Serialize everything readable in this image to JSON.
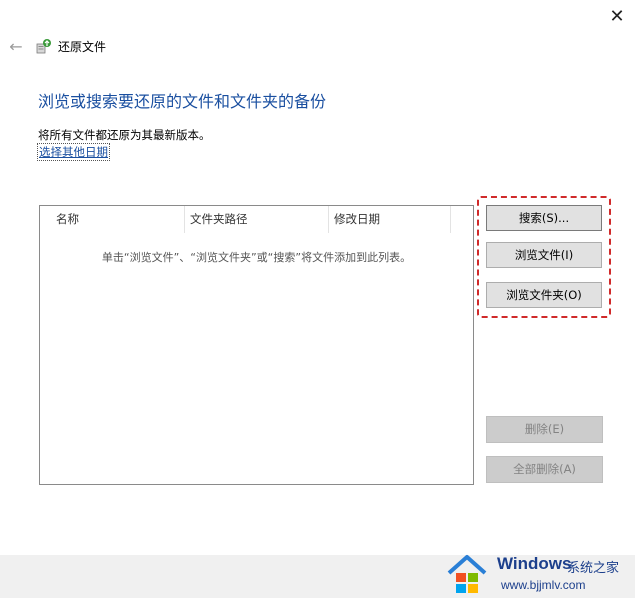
{
  "window": {
    "close_glyph": "✕",
    "back_glyph": "←",
    "title": "还原文件"
  },
  "main": {
    "heading": "浏览或搜索要还原的文件和文件夹的备份",
    "description": "将所有文件都还原为其最新版本。",
    "choose_date_link": "选择其他日期"
  },
  "table": {
    "columns": [
      "名称",
      "文件夹路径",
      "修改日期"
    ],
    "rows": [],
    "empty_message": "单击“浏览文件”、“浏览文件夹”或“搜索”将文件添加到此列表。"
  },
  "buttons": {
    "search": "搜索(S)...",
    "browse_files": "浏览文件(I)",
    "browse_folders": "浏览文件夹(O)",
    "delete": "删除(E)",
    "delete_all": "全部删除(A)"
  },
  "watermark": {
    "title": "Windows",
    "subtitle": "系统之家",
    "url": "www.bjjmlv.com"
  },
  "colors": {
    "heading": "#1a4fa0",
    "highlight_frame": "#d02a2a",
    "button_face": "#e1e1e1",
    "disabled_face": "#cccccc",
    "footer": "#f0f0f0"
  }
}
